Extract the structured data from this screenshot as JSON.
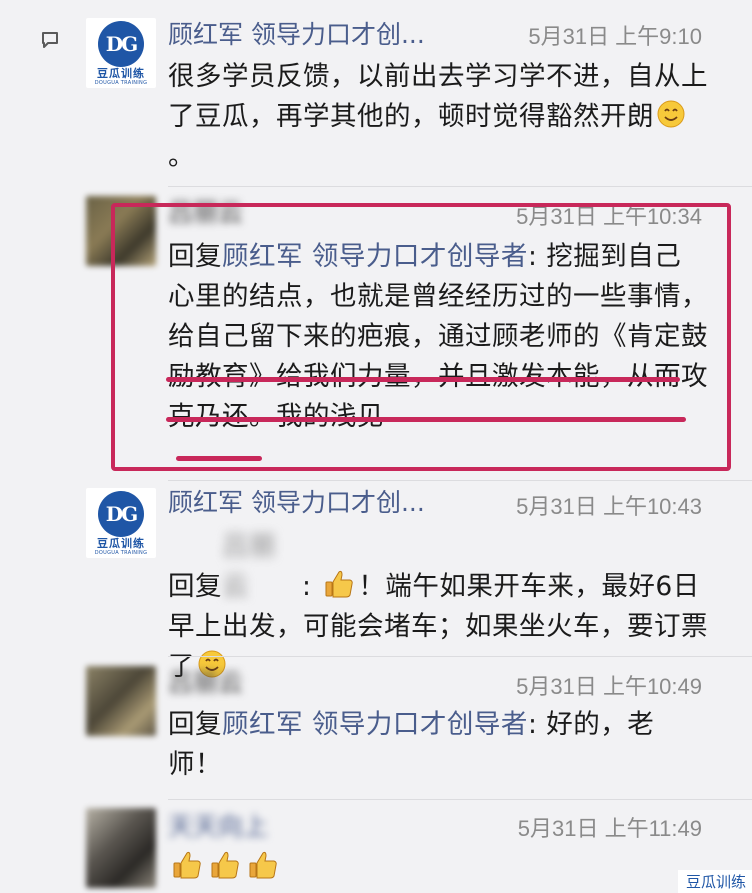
{
  "comments": [
    {
      "sender": "顾红军 领导力口才创...",
      "time": "5月31日 上午9:10",
      "text": "很多学员反馈，以前出去学习学不进，自从上了豆瓜，再学其他的，顿时觉得豁然开朗",
      "text_tail": "。",
      "avatar_brand": "豆瓜训练",
      "avatar_brand_en": "DOUGUA TRAINING",
      "avatar_initials": "DG"
    },
    {
      "sender": "吕丽云",
      "time": "5月31日 上午10:34",
      "reply_prefix": "回复",
      "reply_to": "顾红军 领导力口才创导者",
      "text": ": 挖掘到自己心里的结点，也就是曾经经历过的一些事情，给自己留下来的疤痕，通过顾老师的《肯定鼓励教育》给我们力量，并且激发本能，从而攻克乃还。我的浅见"
    },
    {
      "sender": "顾红军 领导力口才创...",
      "time": "5月31日 上午10:43",
      "reply_prefix": "回复",
      "reply_to": "吕丽云",
      "text_a": "！端午如果开车来，最好6日早上出发，可能会堵车；如果坐火车，要订票了",
      "avatar_brand": "豆瓜训练",
      "avatar_brand_en": "DOUGUA TRAINING",
      "avatar_initials": "DG"
    },
    {
      "sender": "吕丽云",
      "time": "5月31日 上午10:49",
      "reply_prefix": "回复",
      "reply_to": "顾红军 领导力口才创导者",
      "text": ": 好的，老师！"
    },
    {
      "sender": "天天向上",
      "time": "5月31日 上午11:49"
    }
  ],
  "watermark": "豆瓜训练",
  "colors": {
    "highlight": "#c8285a",
    "sender_name": "#4a5d8c",
    "brand_blue": "#1f56a6"
  },
  "icons": [
    "comment-icon",
    "smile-emoji-icon",
    "thumbs-up-emoji-icon"
  ]
}
